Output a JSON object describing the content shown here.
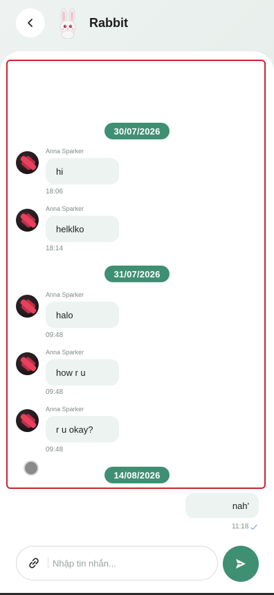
{
  "header": {
    "title": "Rabbit",
    "back_icon": "chevron-left-icon",
    "avatar_icon": "rabbit-avatar"
  },
  "chat": {
    "groups": [
      {
        "date": "30/07/2026",
        "messages": [
          {
            "sender": "Anna Sparker",
            "text": "hi",
            "time": "18:06"
          },
          {
            "sender": "Anna Sparker",
            "text": "helklko",
            "time": "18:14"
          }
        ]
      },
      {
        "date": "31/07/2026",
        "messages": [
          {
            "sender": "Anna Sparker",
            "text": "halo",
            "time": "09:48"
          },
          {
            "sender": "Anna Sparker",
            "text": "how r u",
            "time": "09:48"
          },
          {
            "sender": "Anna Sparker",
            "text": "r u okay?",
            "time": "09:48"
          }
        ]
      },
      {
        "date": "14/08/2026",
        "messages": []
      }
    ],
    "outgoing": {
      "text": "nah'",
      "time": "11:18"
    }
  },
  "composer": {
    "placeholder": "Nhập tin nhắn...",
    "attach_icon": "paperclip-icon",
    "send_icon": "send-icon"
  },
  "colors": {
    "accent": "#3f8f73",
    "bubble": "#ecf3f1",
    "highlight": "#c8262f"
  }
}
